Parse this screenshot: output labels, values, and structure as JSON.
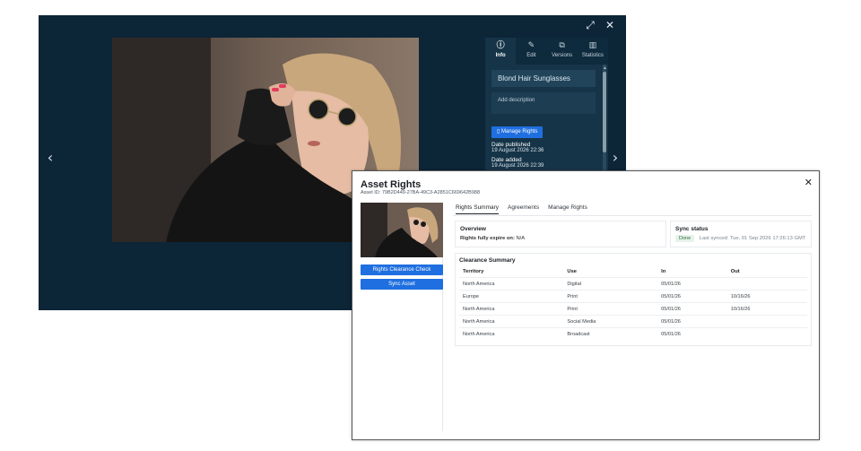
{
  "viewer": {
    "prev_arrow": "‹",
    "next_arrow": "›",
    "expand_icon": "⤢",
    "close_icon": "✕"
  },
  "side_panel": {
    "tabs": [
      {
        "label": "Info",
        "icon": "info-icon",
        "glyph": "ⓘ"
      },
      {
        "label": "Edit",
        "icon": "edit-icon",
        "glyph": "✎"
      },
      {
        "label": "Versions",
        "icon": "versions-icon",
        "glyph": "⧉"
      },
      {
        "label": "Statistics",
        "icon": "statistics-icon",
        "glyph": "▥"
      }
    ],
    "title_value": "Blond Hair Sunglasses",
    "description_placeholder": "Add description",
    "manage_rights_label": "Manage Rights",
    "date_published_label": "Date published",
    "date_published_value": "19 August 2026 22:36",
    "date_added_label": "Date added",
    "date_added_value": "19 August 2026 22:39"
  },
  "modal": {
    "title": "Asset Rights",
    "asset_id": "Asset ID: 79B2D449-27BA-49C3-A2851C669642B988",
    "close_glyph": "✕",
    "rights_clearance_label": "Rights Clearance Check",
    "sync_asset_label": "Sync Asset",
    "tabs": [
      "Rights Summary",
      "Agreements",
      "Manage Rights"
    ],
    "overview": {
      "heading": "Overview",
      "expire_label": "Rights fully expire on:",
      "expire_value": "N/A"
    },
    "sync_status": {
      "heading": "Sync status",
      "badge": "Done",
      "last_synced": "Last synced: Tue, 01 Sep 2026 17:26:13 GMT"
    },
    "clearance": {
      "heading": "Clearance Summary",
      "columns": [
        "Territory",
        "Use",
        "In",
        "Out"
      ],
      "rows": [
        [
          "North America",
          "Digital",
          "05/01/26",
          ""
        ],
        [
          "Europe",
          "Print",
          "05/01/26",
          "10/16/26"
        ],
        [
          "North America",
          "Print",
          "05/01/26",
          "10/16/26"
        ],
        [
          "North America",
          "Social Media",
          "05/01/26",
          ""
        ],
        [
          "North America",
          "Broadcast",
          "05/01/26",
          ""
        ]
      ]
    }
  }
}
